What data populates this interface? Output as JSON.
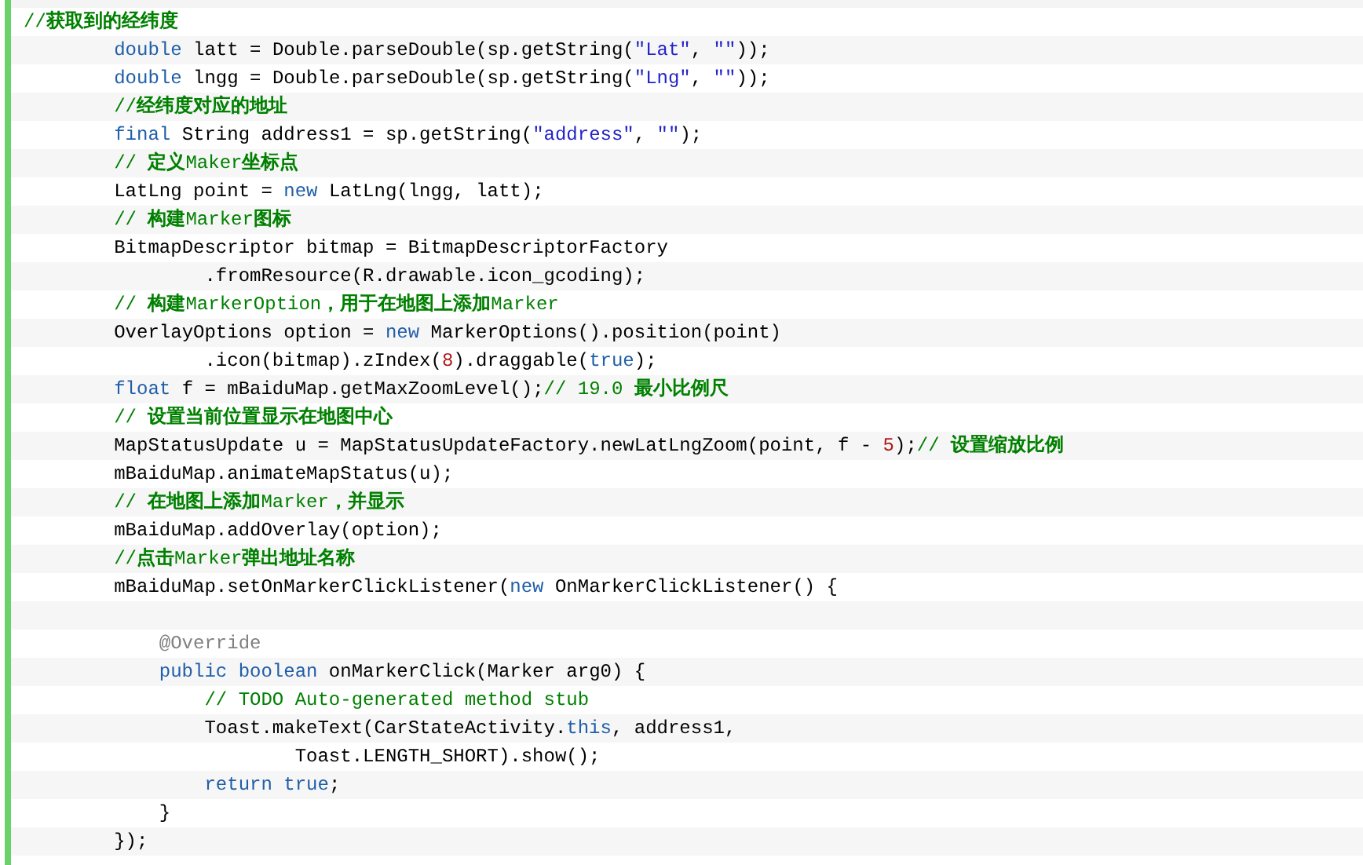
{
  "code_block": {
    "lines": [
      {
        "kind": "flush",
        "tokens": [
          {
            "kind": "comment",
            "text": "//**获取到的经纬度**"
          }
        ]
      },
      {
        "kind": "block",
        "tokens": [
          {
            "kind": "keyword",
            "text": "double"
          },
          {
            "kind": "plain",
            "text": " latt = Double.parseDouble(sp.getString("
          },
          {
            "kind": "string",
            "text": "\"Lat\""
          },
          {
            "kind": "plain",
            "text": ", "
          },
          {
            "kind": "string",
            "text": "\"\""
          },
          {
            "kind": "plain",
            "text": "));"
          }
        ]
      },
      {
        "kind": "block",
        "tokens": [
          {
            "kind": "keyword",
            "text": "double"
          },
          {
            "kind": "plain",
            "text": " lngg = Double.parseDouble(sp.getString("
          },
          {
            "kind": "string",
            "text": "\"Lng\""
          },
          {
            "kind": "plain",
            "text": ", "
          },
          {
            "kind": "string",
            "text": "\"\""
          },
          {
            "kind": "plain",
            "text": "));"
          }
        ]
      },
      {
        "kind": "block",
        "tokens": [
          {
            "kind": "comment",
            "text": "//**经纬度对应的地址**"
          }
        ]
      },
      {
        "kind": "block",
        "tokens": [
          {
            "kind": "keyword",
            "text": "final"
          },
          {
            "kind": "plain",
            "text": " String address1 = sp.getString("
          },
          {
            "kind": "string",
            "text": "\"address\""
          },
          {
            "kind": "plain",
            "text": ", "
          },
          {
            "kind": "string",
            "text": "\"\""
          },
          {
            "kind": "plain",
            "text": ");"
          }
        ]
      },
      {
        "kind": "block",
        "tokens": [
          {
            "kind": "comment",
            "text": "// **定义**Maker**坐标点**"
          }
        ]
      },
      {
        "kind": "block",
        "tokens": [
          {
            "kind": "plain",
            "text": "LatLng point = "
          },
          {
            "kind": "keyword",
            "text": "new"
          },
          {
            "kind": "plain",
            "text": " LatLng(lngg, latt);"
          }
        ]
      },
      {
        "kind": "block",
        "tokens": [
          {
            "kind": "comment",
            "text": "// **构建**Marker**图标**"
          }
        ]
      },
      {
        "kind": "block",
        "tokens": [
          {
            "kind": "plain",
            "text": "BitmapDescriptor bitmap = BitmapDescriptorFactory"
          }
        ]
      },
      {
        "kind": "deeper",
        "tokens": [
          {
            "kind": "plain",
            "text": ".fromResource(R.drawable.icon_gcoding);"
          }
        ]
      },
      {
        "kind": "block",
        "tokens": [
          {
            "kind": "comment",
            "text": "// **构建**MarkerOption**，用于在地图上添加**Marker"
          }
        ]
      },
      {
        "kind": "block",
        "tokens": [
          {
            "kind": "plain",
            "text": "OverlayOptions option = "
          },
          {
            "kind": "keyword",
            "text": "new"
          },
          {
            "kind": "plain",
            "text": " MarkerOptions().position(point)"
          }
        ]
      },
      {
        "kind": "deeper",
        "tokens": [
          {
            "kind": "plain",
            "text": ".icon(bitmap).zIndex("
          },
          {
            "kind": "number",
            "text": "8"
          },
          {
            "kind": "plain",
            "text": ").draggable("
          },
          {
            "kind": "keyword",
            "text": "true"
          },
          {
            "kind": "plain",
            "text": ");"
          }
        ]
      },
      {
        "kind": "block",
        "tokens": [
          {
            "kind": "keyword",
            "text": "float"
          },
          {
            "kind": "plain",
            "text": " f = mBaiduMap.getMaxZoomLevel();"
          },
          {
            "kind": "comment",
            "text": "// 19.0 **最小比例尺**"
          }
        ]
      },
      {
        "kind": "block",
        "tokens": [
          {
            "kind": "comment",
            "text": "// **设置当前位置显示在地图中心**"
          }
        ]
      },
      {
        "kind": "block",
        "tokens": [
          {
            "kind": "plain",
            "text": "MapStatusUpdate u = MapStatusUpdateFactory.newLatLngZoom(point, f - "
          },
          {
            "kind": "number",
            "text": "5"
          },
          {
            "kind": "plain",
            "text": ");"
          },
          {
            "kind": "comment",
            "text": "// **设置缩放比例**"
          }
        ]
      },
      {
        "kind": "block",
        "tokens": [
          {
            "kind": "plain",
            "text": "mBaiduMap.animateMapStatus(u);"
          }
        ]
      },
      {
        "kind": "block",
        "tokens": [
          {
            "kind": "comment",
            "text": "// **在地图上添加**Marker**，并显示**"
          }
        ]
      },
      {
        "kind": "block",
        "tokens": [
          {
            "kind": "plain",
            "text": "mBaiduMap.addOverlay(option);"
          }
        ]
      },
      {
        "kind": "block",
        "tokens": [
          {
            "kind": "comment",
            "text": "//**点击**Marker**弹出地址名称**"
          }
        ]
      },
      {
        "kind": "block",
        "tokens": [
          {
            "kind": "plain",
            "text": "mBaiduMap.setOnMarkerClickListener("
          },
          {
            "kind": "keyword",
            "text": "new"
          },
          {
            "kind": "plain",
            "text": " OnMarkerClickListener() {"
          }
        ]
      },
      {
        "kind": "blank"
      },
      {
        "kind": "inner",
        "tokens": [
          {
            "kind": "annotation",
            "text": "@Override"
          }
        ]
      },
      {
        "kind": "inner",
        "tokens": [
          {
            "kind": "keyword",
            "text": "public"
          },
          {
            "kind": "keyword",
            "text": " boolean"
          },
          {
            "kind": "plain",
            "text": " onMarkerClick(Marker arg0) {"
          }
        ]
      },
      {
        "kind": "deeper",
        "tokens": [
          {
            "kind": "comment",
            "text": "// TODO Auto-generated method stub"
          }
        ]
      },
      {
        "kind": "deeper",
        "tokens": [
          {
            "kind": "plain",
            "text": "Toast.makeText(CarStateActivity."
          },
          {
            "kind": "keyword",
            "text": "this"
          },
          {
            "kind": "plain",
            "text": ", address1,"
          }
        ]
      },
      {
        "kind": "wrapped",
        "tokens": [
          {
            "kind": "plain",
            "text": "Toast.LENGTH_SHORT).show();"
          }
        ]
      },
      {
        "kind": "deeper",
        "tokens": [
          {
            "kind": "keyword",
            "text": "return"
          },
          {
            "kind": "keyword",
            "text": " true"
          },
          {
            "kind": "plain",
            "text": ";"
          }
        ]
      },
      {
        "kind": "inner",
        "tokens": [
          {
            "kind": "plain",
            "text": "}"
          }
        ]
      },
      {
        "kind": "block",
        "tokens": [
          {
            "kind": "plain",
            "text": "});"
          }
        ]
      }
    ]
  }
}
